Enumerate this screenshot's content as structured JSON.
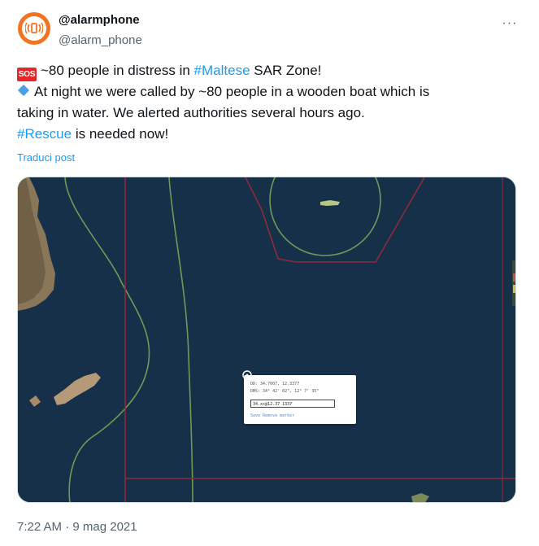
{
  "author": {
    "display_name": "@alarmphone",
    "handle": "@alarm_phone",
    "avatar_icon": "phone-signal-icon",
    "avatar_color": "#f27420"
  },
  "menu": {
    "more_label": "···"
  },
  "tweet": {
    "sos_badge": "SOS",
    "line1_before": "~80 people in distress in ",
    "line1_hashtag": "#Maltese",
    "line1_after": " SAR Zone!",
    "line2": "At night we were called by ~80 people in a wooden boat which is",
    "line3": "taking in water. We alerted authorities several hours ago.",
    "line4_hashtag": "#Rescue",
    "line4_after": " is needed now!"
  },
  "translate_label": "Traduci post",
  "map_popup": {
    "line1": "DD: 34.7007, 12.3377",
    "line2": "DMS: 34° 42' 02\", 12° 7' 35\"",
    "input_value": "34.xx@12.37 1337",
    "links": "Save   Remove marker"
  },
  "timestamp": "7:22 AM · 9 mag 2021",
  "colors": {
    "hashtag": "#1d9bf0",
    "sea": "#17304a",
    "sar_boundary": "#8b2b3a",
    "zone_line": "#6f9a55",
    "land": "#a88a6a"
  }
}
